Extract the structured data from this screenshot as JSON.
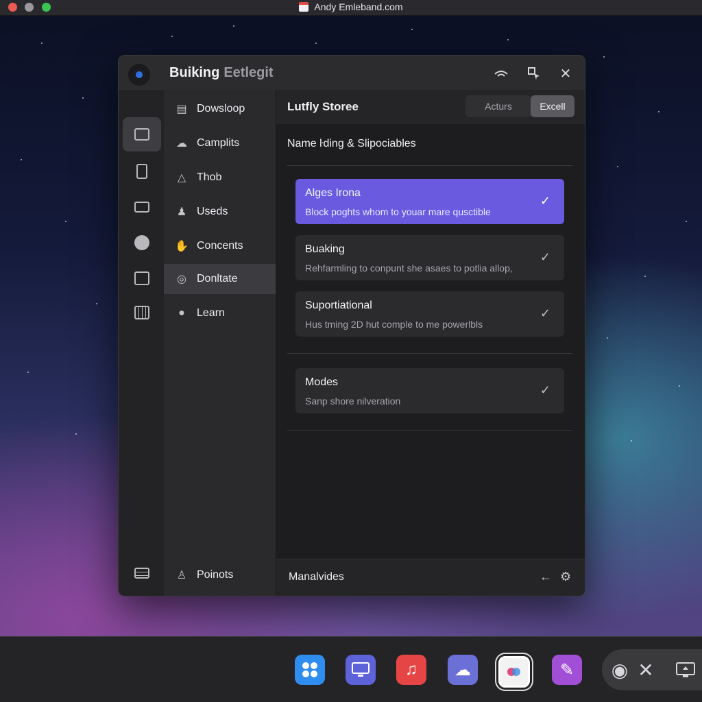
{
  "menubar": {
    "title": "Andy Emleband.com",
    "title_icon": "calendar-icon"
  },
  "window": {
    "app_title": "Buiking",
    "app_subtitle": "Eetlegit",
    "header_buttons": [
      "wifi-icon",
      "settings-cursor-icon",
      "close-icon"
    ]
  },
  "rail": {
    "icons": [
      "display-icon",
      "tablet-icon",
      "presentation-icon",
      "info-icon",
      "monitor-icon",
      "calendar-grid-icon",
      "list-icon"
    ],
    "active_index": 0
  },
  "nav": {
    "items": [
      {
        "label": "Dowsloop",
        "icon": "briefcase-icon"
      },
      {
        "label": "Camplits",
        "icon": "cloud-icon"
      },
      {
        "label": "Thob",
        "icon": "warning-icon"
      },
      {
        "label": "Useds",
        "icon": "user-icon"
      },
      {
        "label": "Concents",
        "icon": "hand-icon"
      },
      {
        "label": "Donltate",
        "icon": "donate-icon"
      },
      {
        "label": "Learn",
        "icon": "chat-icon"
      }
    ],
    "active_index": 5,
    "footer": {
      "label": "Poinots",
      "icon": "person-icon"
    }
  },
  "content": {
    "title": "Lutfly Storee",
    "actions_label": "Acturs",
    "excel_label": "Excell",
    "section_title": "Name ŀding & Slipociables",
    "cards": [
      {
        "title": "Alges Irona",
        "desc": "Block poghts whom to youar mare qusctible",
        "selected": true
      },
      {
        "title": "Buaking",
        "desc": "Rehfarmling to conpunt she asaes to potlia allop,",
        "selected": false
      },
      {
        "title": "Suportiational",
        "desc": "Hus tming 2D hut comple to me powerlbls",
        "selected": false
      },
      {
        "title": "Modes",
        "desc": "Sanp shore nilveration",
        "selected": false
      }
    ],
    "footer_title": "Manalvides"
  },
  "dock": {
    "apps": [
      {
        "name": "launchpad-icon",
        "color": "#2f8df0"
      },
      {
        "name": "monitor-app-icon",
        "color": "#5e62d8"
      },
      {
        "name": "music-icon",
        "color": "#e64545"
      },
      {
        "name": "cloud-app-icon",
        "color": "#6a70d6"
      },
      {
        "name": "photos-icon",
        "color": "#f2f2f2"
      },
      {
        "name": "pen-app-icon",
        "color": "#a24fd8"
      }
    ],
    "controls": [
      "record-icon",
      "close-icon",
      "screen-share-icon"
    ]
  }
}
